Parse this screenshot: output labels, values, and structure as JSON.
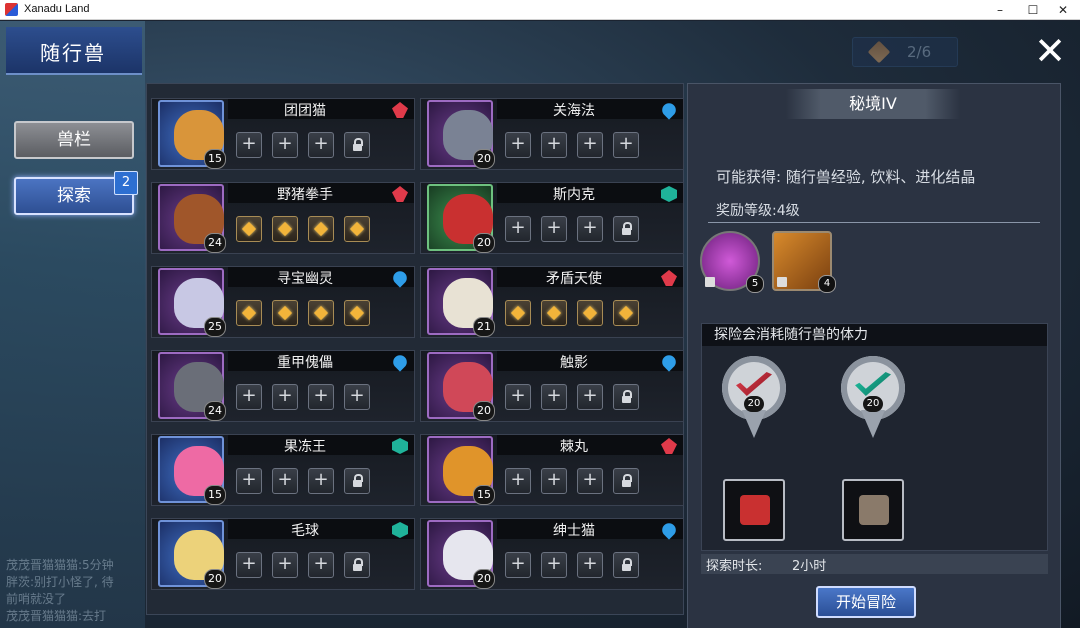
{
  "window": {
    "title": "Xanadu Land",
    "min": "–",
    "max": "☐",
    "close": "✕"
  },
  "sidebar": {
    "title": "随行兽",
    "beast_tab": "兽栏",
    "explore_tab": "探索",
    "explore_badge": "2",
    "chat_lines": [
      "茂茂晋猫猫猫:5分钟",
      "胖茨:别打小怪了, 待",
      "前哨就没了",
      "茂茂晋猫猫猫:去打"
    ]
  },
  "counter": {
    "value": "2/6"
  },
  "close_label": "✕",
  "pets": [
    {
      "name": "团团猫",
      "level": "15",
      "element": "fire",
      "frame": "blue",
      "slots": [
        "plus",
        "plus",
        "plus",
        "lock"
      ],
      "color": "#d9953a"
    },
    {
      "name": "关海法",
      "level": "20",
      "element": "water",
      "frame": "purple",
      "slots": [
        "plus",
        "plus",
        "plus",
        "plus"
      ],
      "color": "#7a8294"
    },
    {
      "name": "野猪拳手",
      "level": "24",
      "element": "fire",
      "frame": "purple",
      "slots": [
        "gem",
        "gem",
        "gem",
        "gem"
      ],
      "color": "#a0562a"
    },
    {
      "name": "斯内克",
      "level": "20",
      "element": "earth",
      "frame": "green",
      "slots": [
        "plus",
        "plus",
        "plus",
        "lock"
      ],
      "color": "#c93030"
    },
    {
      "name": "寻宝幽灵",
      "level": "25",
      "element": "water",
      "frame": "purple",
      "slots": [
        "gem",
        "gem",
        "gem",
        "gem"
      ],
      "color": "#c8c8e4"
    },
    {
      "name": "矛盾天使",
      "level": "21",
      "element": "fire",
      "frame": "purple",
      "slots": [
        "gem",
        "gem",
        "gem",
        "gem"
      ],
      "color": "#e8e2d4"
    },
    {
      "name": "重甲傀儡",
      "level": "24",
      "element": "water",
      "frame": "purple",
      "slots": [
        "plus",
        "plus",
        "plus",
        "plus"
      ],
      "color": "#6a6e78"
    },
    {
      "name": "触影",
      "level": "20",
      "element": "water",
      "frame": "purple",
      "slots": [
        "plus",
        "plus",
        "plus",
        "lock"
      ],
      "color": "#d04858"
    },
    {
      "name": "果冻王",
      "level": "15",
      "element": "earth",
      "frame": "blue",
      "slots": [
        "plus",
        "plus",
        "plus",
        "lock"
      ],
      "color": "#ee6aa4"
    },
    {
      "name": "棘丸",
      "level": "15",
      "element": "fire",
      "frame": "purple",
      "slots": [
        "plus",
        "plus",
        "plus",
        "lock"
      ],
      "color": "#e0942a"
    },
    {
      "name": "毛球",
      "level": "20",
      "element": "earth",
      "frame": "blue",
      "slots": [
        "plus",
        "plus",
        "plus",
        "lock"
      ],
      "color": "#ecd27a"
    },
    {
      "name": "绅士猫",
      "level": "20",
      "element": "water",
      "frame": "purple",
      "slots": [
        "plus",
        "plus",
        "plus",
        "lock"
      ],
      "color": "#e6e6ee"
    }
  ],
  "realm": {
    "title": "秘境IV",
    "rewards_text": "可能获得: 随行兽经验, 饮料、进化结晶",
    "reward_level": "奖励等级:4级",
    "reward_items": [
      {
        "name": "purple-orb",
        "count": "5"
      },
      {
        "name": "mystery-box",
        "count": "4"
      }
    ],
    "consume_text": "探险会消耗随行兽的体力",
    "requirements": [
      {
        "element": "fire",
        "value": "20"
      },
      {
        "element": "earth",
        "value": "20"
      }
    ],
    "duration_label": "探索时长:",
    "duration_value": "2小时",
    "start_button": "开始冒险"
  },
  "colors": {
    "accent": "#3f6fc4",
    "fire": "#e03a4a",
    "water": "#2e9de8",
    "earth": "#1fb39a"
  }
}
